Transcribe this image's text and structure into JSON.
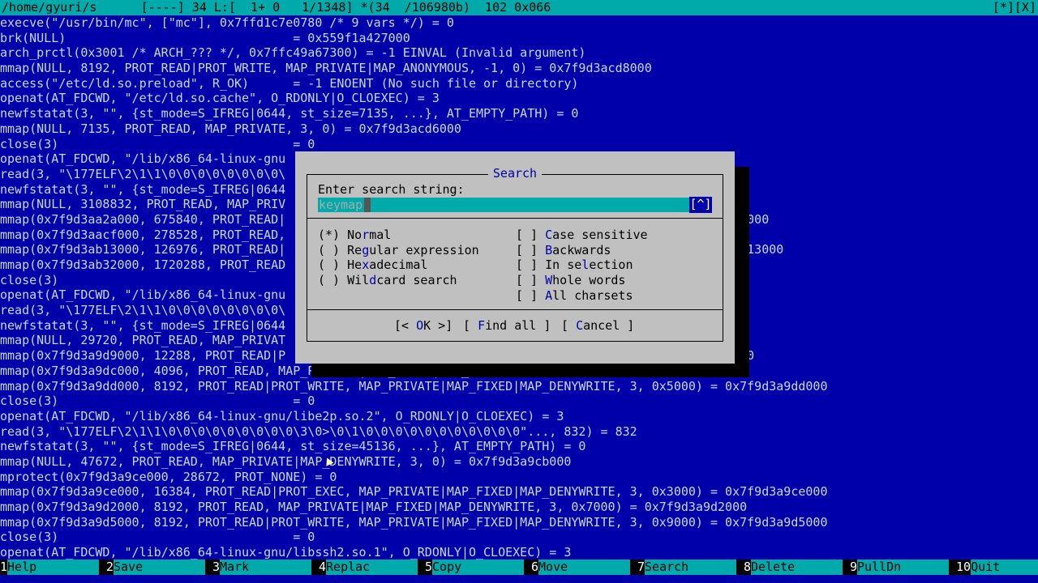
{
  "status": {
    "path": "/home/gyuri/s",
    "info": "      [----] 34 L:[  1+ 0   1/1348] *(34  /106980b)  102 0x066",
    "right": "[*][X]"
  },
  "editor_lines": [
    "execve(\"/usr/bin/mc\", [\"mc\"], 0x7ffd1c7e0780 /* 9 vars */) = 0",
    "brk(NULL)                               = 0x559f1a427000",
    "arch_prctl(0x3001 /* ARCH_??? */, 0x7ffc49a67300) = -1 EINVAL (Invalid argument)",
    "mmap(NULL, 8192, PROT_READ|PROT_WRITE, MAP_PRIVATE|MAP_ANONYMOUS, -1, 0) = 0x7f9d3acd8000",
    "access(\"/etc/ld.so.preload\", R_OK)      = -1 ENOENT (No such file or directory)",
    "openat(AT_FDCWD, \"/etc/ld.so.cache\", O_RDONLY|O_CLOEXEC) = 3",
    "newfstatat(3, \"\", {st_mode=S_IFREG|0644, st_size=7135, ...}, AT_EMPTY_PATH) = 0",
    "mmap(NULL, 7135, PROT_READ, MAP_PRIVATE, 3, 0) = 0x7f9d3acd6000",
    "close(3)                                = 0",
    "openat(AT_FDCWD, \"/lib/x86_64-linux-gnu",
    "read(3, \"\\177ELF\\2\\1\\1\\0\\0\\0\\0\\0\\0\\0\\0\\",
    "newfstatat(3, \"\", {st_mode=S_IFREG|0644",
    "mmap(NULL, 3108832, PROT_READ, MAP_PRIV",
    "mmap(0x7f9d3aa2a000, 675840, PROT_READ|                                                ) = 0x7f9d3aa2a000",
    "mmap(0x7f9d3aacf000, 278528, PROT_READ,                                                3aacf000",
    "mmap(0x7f9d3ab13000, 126976, PROT_READ|                                                00) = 0x7f9d3ab13000",
    "mmap(0x7f9d3ab32000, 1720288, PROT_READ                                                 0x7f9d3ab32000",
    "close(3)",
    "openat(AT_FDCWD, \"/lib/x86_64-linux-gnu",
    "read(3, \"\\177ELF\\2\\1\\1\\0\\0\\0\\0\\0\\0\\0\\0\\",
    "newfstatat(3, \"\", {st_mode=S_IFREG|0644",
    "mmap(NULL, 29720, PROT_READ, MAP_PRIVAT",
    "mmap(0x7f9d3a9d9000, 12288, PROT_READ|P                                                  0x7f9d3a9d9000",
    "mmap(0x7f9d3a9dc000, 4096, PROT_READ, MAP_PRIVATE|MAP_FIXED|MAP_DENYWRITE, 3, 0x5000) = 0x7f9d3a9dc000",
    "mmap(0x7f9d3a9dd000, 8192, PROT_READ|PROT_WRITE, MAP_PRIVATE|MAP_FIXED|MAP_DENYWRITE, 3, 0x5000) = 0x7f9d3a9dd000",
    "close(3)                                = 0",
    "openat(AT_FDCWD, \"/lib/x86_64-linux-gnu/libe2p.so.2\", O_RDONLY|O_CLOEXEC) = 3",
    "read(3, \"\\177ELF\\2\\1\\1\\0\\0\\0\\0\\0\\0\\0\\0\\0\\3\\0>\\0\\1\\0\\0\\0\\0\\0\\0\\0\\0\\0\\0\\0\"..., 832) = 832",
    "newfstatat(3, \"\", {st_mode=S_IFREG|0644, st_size=45136, ...}, AT_EMPTY_PATH) = 0",
    "mmap(NULL, 47672, PROT_READ, MAP_PRIVATE|MAP_DENYWRITE, 3, 0) = 0x7f9d3a9cb000",
    "mprotect(0x7f9d3a9ce000, 28672, PROT_NONE) = 0",
    "mmap(0x7f9d3a9ce000, 16384, PROT_READ|PROT_EXEC, MAP_PRIVATE|MAP_FIXED|MAP_DENYWRITE, 3, 0x3000) = 0x7f9d3a9ce000",
    "mmap(0x7f9d3a9d2000, 8192, PROT_READ, MAP_PRIVATE|MAP_FIXED|MAP_DENYWRITE, 3, 0x7000) = 0x7f9d3a9d2000",
    "mmap(0x7f9d3a9d5000, 8192, PROT_READ|PROT_WRITE, MAP_PRIVATE|MAP_FIXED|MAP_DENYWRITE, 3, 0x9000) = 0x7f9d3a9d5000",
    "close(3)                                = 0",
    "openat(AT_FDCWD, \"/lib/x86_64-linux-gnu/libssh2.so.1\", O_RDONLY|O_CLOEXEC) = 3"
  ],
  "dialog": {
    "title": "Search",
    "prompt": "Enter search string:",
    "input_value": "keymap",
    "history_label": "[^]",
    "radio": {
      "normal": {
        "mark": "(*) ",
        "pre": "No",
        "hot": "r",
        "post": "mal"
      },
      "regex": {
        "mark": "( ) ",
        "pre": "Re",
        "hot": "g",
        "post": "ular expression"
      },
      "hex": {
        "mark": "( ) ",
        "pre": "He",
        "hot": "x",
        "post": "adecimal"
      },
      "wild": {
        "mark": "( ) ",
        "pre": "Wil",
        "hot": "d",
        "post": "card search"
      }
    },
    "checks": {
      "case": {
        "mark": "[ ] ",
        "pre": "",
        "hot": "C",
        "post": "ase sensitive"
      },
      "back": {
        "mark": "[ ] ",
        "pre": "",
        "hot": "B",
        "post": "ackwards"
      },
      "sel": {
        "mark": "[ ] ",
        "pre": "In se",
        "hot": "l",
        "post": "ection"
      },
      "whole": {
        "mark": "[ ] ",
        "pre": "",
        "hot": "W",
        "post": "hole words"
      },
      "all": {
        "mark": "[ ] ",
        "pre": "",
        "hot": "A",
        "post": "ll charsets"
      }
    },
    "buttons": {
      "ok": {
        "pre": "[< ",
        "hot": "O",
        "post": "K >]"
      },
      "findall": {
        "pre": "[ ",
        "hot": "F",
        "post": "ind all ]"
      },
      "cancel": {
        "pre": "[ ",
        "hot": "C",
        "post": "ancel ]"
      }
    }
  },
  "fnkeys": [
    {
      "num": "1",
      "label": "Help"
    },
    {
      "num": "2",
      "label": "Save"
    },
    {
      "num": "3",
      "label": "Mark"
    },
    {
      "num": "4",
      "label": "Replac"
    },
    {
      "num": "5",
      "label": "Copy"
    },
    {
      "num": "6",
      "label": "Move"
    },
    {
      "num": "7",
      "label": "Search"
    },
    {
      "num": "8",
      "label": "Delete"
    },
    {
      "num": "9",
      "label": "PullDn"
    },
    {
      "num": "10",
      "label": "Quit"
    }
  ],
  "colors": {
    "background": "#0000aa",
    "bar": "#00aaaa",
    "dialog": "#c0c0c0",
    "hotkey": "#0000aa"
  }
}
